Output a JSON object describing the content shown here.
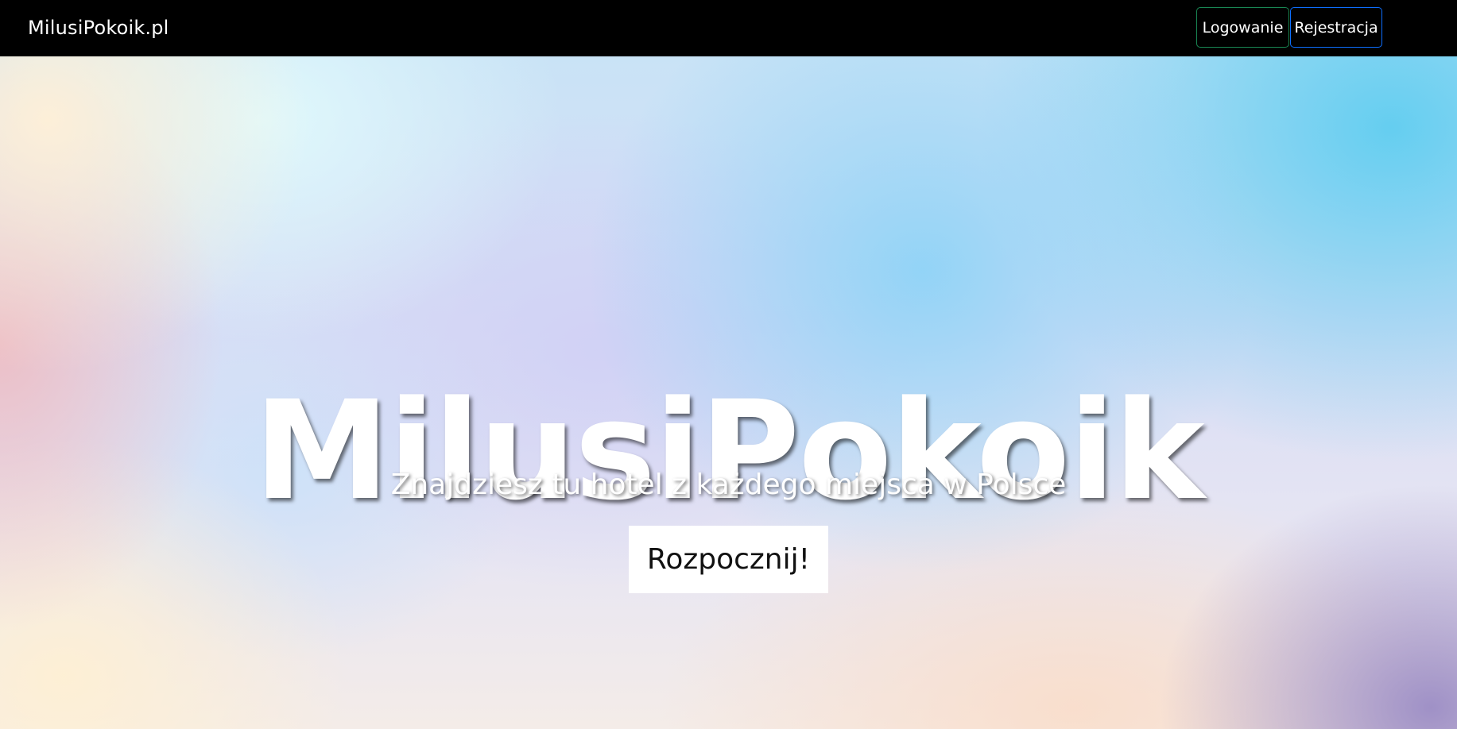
{
  "navbar": {
    "brand": "MilusiPokoik.pl",
    "login_label": "Logowanie",
    "register_label": "Rejestracja"
  },
  "hero": {
    "title": "MilusiPokoik",
    "subtitle": "Znajdziesz tu hotel z każdego miejsca w Polsce",
    "cta_label": "Rozpocznij!"
  },
  "colors": {
    "navbar_background": "#000000",
    "login_border": "#198754",
    "register_border": "#0d6efd",
    "hero_text": "#ffffff",
    "cta_background": "#ffffff"
  }
}
